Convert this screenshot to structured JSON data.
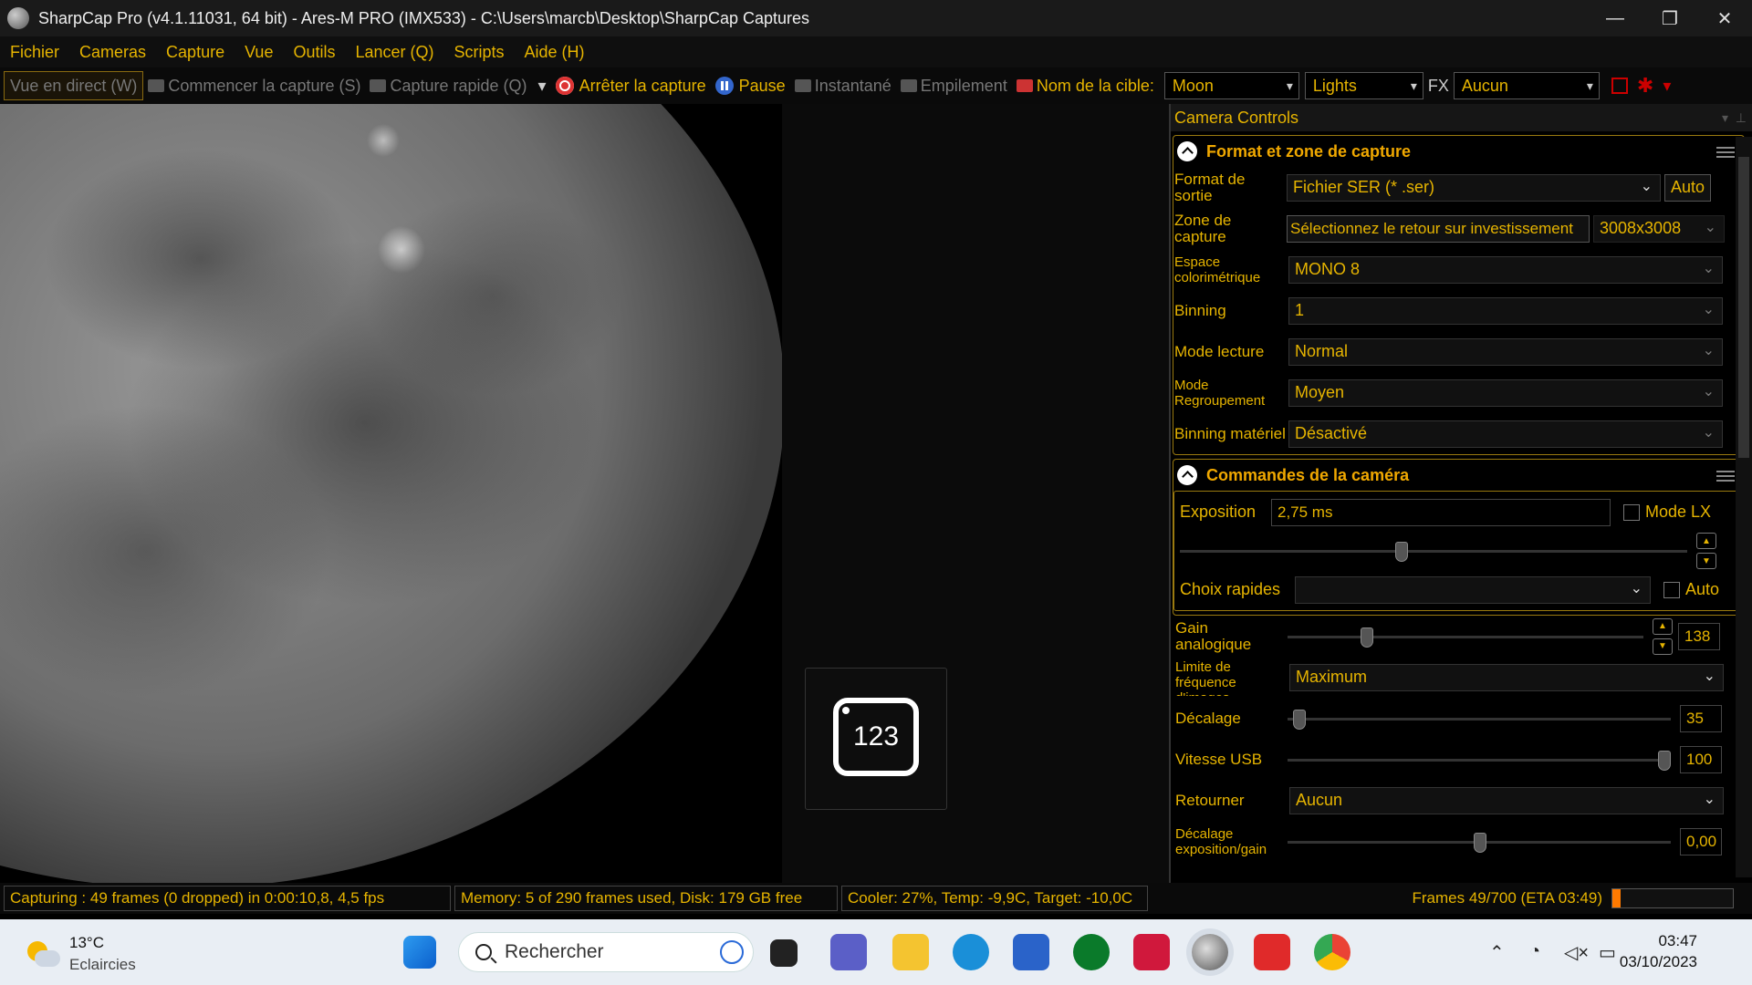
{
  "window": {
    "title": "SharpCap Pro (v4.1.11031, 64 bit) - Ares-M PRO (IMX533) - C:\\Users\\marcb\\Desktop\\SharpCap Captures"
  },
  "menu": [
    "Fichier",
    "Cameras",
    "Capture",
    "Vue",
    "Outils",
    "Lancer (Q)",
    "Scripts",
    "Aide (H)"
  ],
  "toolbar": {
    "live": "Vue en direct (W)",
    "start_capture": "Commencer la capture (S)",
    "quick_capture": "Capture rapide (Q)",
    "stop_capture": "Arrêter la capture",
    "pause": "Pause",
    "snapshot": "Instantané",
    "stacking": "Empilement",
    "target_label": "Nom de la cible:",
    "target_value": "Moon",
    "frame_type": "Lights",
    "fx_label": "FX",
    "fx_value": "Aucun"
  },
  "panel": {
    "header": "Camera Controls",
    "format_section": {
      "title": "Format et zone de capture",
      "output_format_label": "Format de sortie",
      "output_format_value": "Fichier SER (* .ser)",
      "auto_button": "Auto",
      "capture_area_label": "Zone de capture",
      "roi_button": "Sélectionnez le retour sur investissement",
      "capture_area_value": "3008x3008",
      "color_space_label": "Espace colorimétrique",
      "color_space_value": "MONO 8",
      "binning_label": "Binning",
      "binning_value": "1",
      "read_mode_label": "Mode lecture",
      "read_mode_value": "Normal",
      "bin_mode_label": "Mode Regroupement",
      "bin_mode_value": "Moyen",
      "hw_binning_label": "Binning matériel",
      "hw_binning_value": "Désactivé"
    },
    "camera_section": {
      "title": "Commandes de la caméra",
      "exposure_label": "Exposition",
      "exposure_value": "2,75 ms",
      "lx_mode": "Mode LX",
      "quick_picks_label": "Choix rapides",
      "quick_picks_auto": "Auto",
      "gain_label": "Gain analogique",
      "gain_value": "138",
      "frame_limit_label": "Limite de fréquence d'images",
      "frame_limit_value": "Maximum",
      "offset_label": "Décalage",
      "offset_value": "35",
      "usb_label": "Vitesse USB",
      "usb_value": "100",
      "flip_label": "Retourner",
      "flip_value": "Aucun",
      "expgain_label": "Décalage exposition/gain",
      "expgain_value": "0,00"
    }
  },
  "overlay": {
    "counter": "123"
  },
  "status": {
    "capturing": "Capturing : 49 frames (0 dropped) in 0:00:10,8, 4,5 fps",
    "memory": "Memory: 5 of 290 frames used, Disk: 179 GB free",
    "cooler": "Cooler: 27%, Temp: -9,9C, Target: -10,0C",
    "frames": "Frames 49/700 (ETA 03:49)",
    "progress_fraction": 0.07
  },
  "taskbar": {
    "temp": "13°C",
    "weather": "Eclaircies",
    "search_placeholder": "Rechercher",
    "time": "03:47",
    "date": "03/10/2023"
  },
  "colors": {
    "accent": "#e6b400",
    "section_title": "#f0a800",
    "stop": "#dd3333",
    "progress": "#ff7a00"
  }
}
